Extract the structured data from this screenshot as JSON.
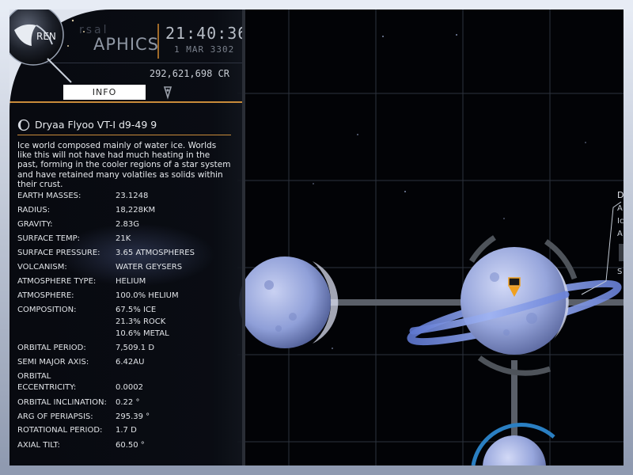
{
  "header": {
    "brand_top": "rsal",
    "brand_bottom": "APHICS",
    "logo_text": "REN",
    "time": "21:40:36",
    "date": "1 MAR 3302",
    "credits": "292,621,698 CR"
  },
  "tabs": {
    "info_label": "INFO",
    "nav_icon": "map-pin-icon"
  },
  "body": {
    "name": "Dryaa Flyoo VT-I d9-49 9",
    "icon": "planet-icon",
    "description": "Ice world composed mainly of water ice. Worlds like this will not have had much heating in the past, forming in the cooler regions of a star system and have retained many volatiles as solids within their crust.",
    "stats": [
      {
        "label": "EARTH MASSES:",
        "value": "23.1248"
      },
      {
        "label": "RADIUS:",
        "value": "18,228KM"
      },
      {
        "label": "GRAVITY:",
        "value": "2.83G"
      },
      {
        "label": "SURFACE TEMP:",
        "value": "21K"
      },
      {
        "label": "SURFACE PRESSURE:",
        "value": "3.65 ATMOSPHERES"
      },
      {
        "label": "VOLCANISM:",
        "value": "WATER GEYSERS"
      },
      {
        "label": "ATMOSPHERE TYPE:",
        "value": "HELIUM"
      },
      {
        "label": "ATMOSPHERE:",
        "value": "100.0% HELIUM"
      },
      {
        "label": "COMPOSITION:",
        "value": "67.5% ICE"
      },
      {
        "label": "",
        "value": "21.3% ROCK"
      },
      {
        "label": "",
        "value": "10.6% METAL"
      },
      {
        "label": "ORBITAL PERIOD:",
        "value": "7,509.1 D"
      },
      {
        "label": "SEMI MAJOR AXIS:",
        "value": "6.42AU"
      },
      {
        "label": "ORBITAL",
        "value": ""
      },
      {
        "label": "ECCENTRICITY:",
        "value": "0.0002"
      },
      {
        "label": "ORBITAL INCLINATION:",
        "value": "0.22 °"
      },
      {
        "label": "ARG OF PERIAPSIS:",
        "value": "295.39 °"
      },
      {
        "label": "ROTATIONAL PERIOD:",
        "value": "1.7 D"
      },
      {
        "label": "AXIAL TILT:",
        "value": "60.50 °"
      }
    ]
  },
  "side_panel": {
    "letters": [
      "D",
      "A",
      "Ic",
      "A",
      "S"
    ]
  },
  "colors": {
    "accent": "#c98b3a",
    "planet": "#8f9fd8",
    "ring": "#7c95e6",
    "marker": "#f0a020",
    "grid": "#303844"
  }
}
